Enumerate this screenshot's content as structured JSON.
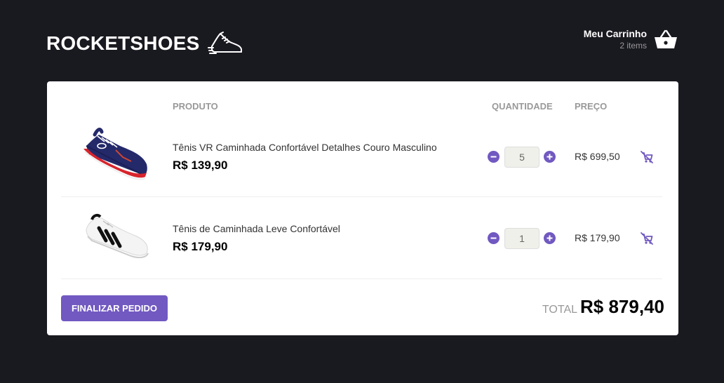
{
  "header": {
    "brand": "ROCKETSHOES",
    "cart_title": "Meu Carrinho",
    "cart_count": "2 items"
  },
  "table": {
    "columns": [
      "PRODUTO",
      "QUANTIDADE",
      "PREÇO"
    ]
  },
  "items": [
    {
      "title": "Tênis VR Caminhada Confortável Detalhes Couro Masculino",
      "price": "R$ 139,90",
      "quantity": "5",
      "subtotal": "R$ 699,50",
      "image": "navy-red-running-shoe"
    },
    {
      "title": "Tênis de Caminhada Leve Confortável",
      "price": "R$ 179,90",
      "quantity": "1",
      "subtotal": "R$ 179,90",
      "image": "white-black-striped-sneaker"
    }
  ],
  "footer": {
    "checkout_label": "FINALIZAR PEDIDO",
    "total_label": "TOTAL",
    "total_value": "R$ 879,40"
  },
  "colors": {
    "background": "#191920",
    "accent": "#7159c1",
    "panel": "#ffffff"
  }
}
